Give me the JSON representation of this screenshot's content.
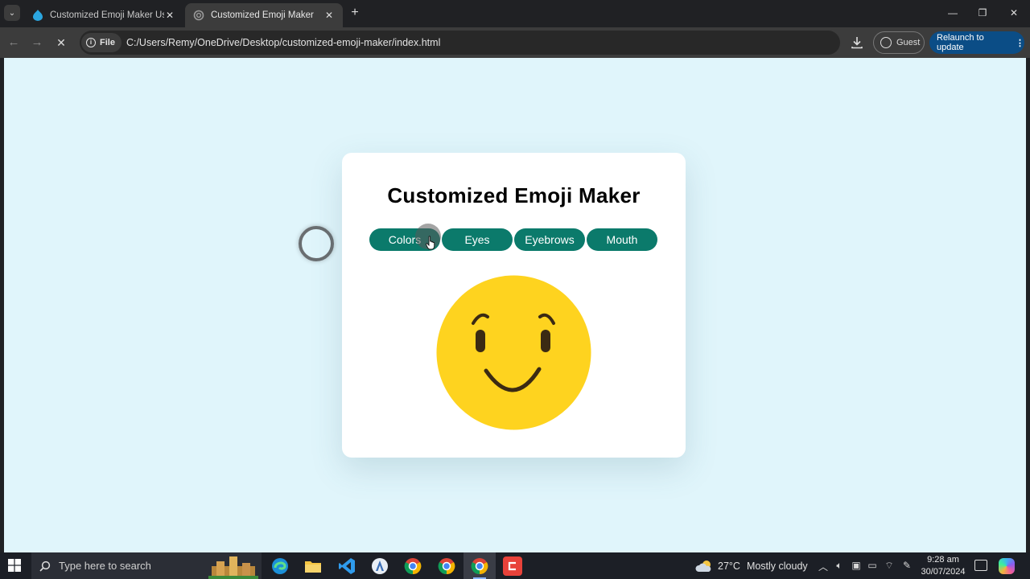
{
  "browser": {
    "tabs": [
      {
        "title": "Customized Emoji Maker Using",
        "active": false,
        "favicon": "drupal-icon"
      },
      {
        "title": "Customized Emoji Maker",
        "active": true,
        "favicon": "loading-icon"
      }
    ],
    "address": {
      "chip_label": "File",
      "url": "C:/Users/Remy/OneDrive/Desktop/customized-emoji-maker/index.html"
    },
    "profile_label": "Guest",
    "update_label": "Relaunch to update"
  },
  "page": {
    "title": "Customized Emoji Maker",
    "buttons": [
      "Colors",
      "Eyes",
      "Eyebrows",
      "Mouth"
    ],
    "emoji": {
      "face_color": "#fed31f",
      "feature_color": "#3b2a13"
    },
    "button_color": "#0b7a6b",
    "background_color": "#e0f5fb"
  },
  "taskbar": {
    "search_placeholder": "Type here to search",
    "weather": {
      "temp": "27°C",
      "condition": "Mostly cloudy"
    },
    "time": "9:28 am",
    "date": "30/07/2024"
  }
}
